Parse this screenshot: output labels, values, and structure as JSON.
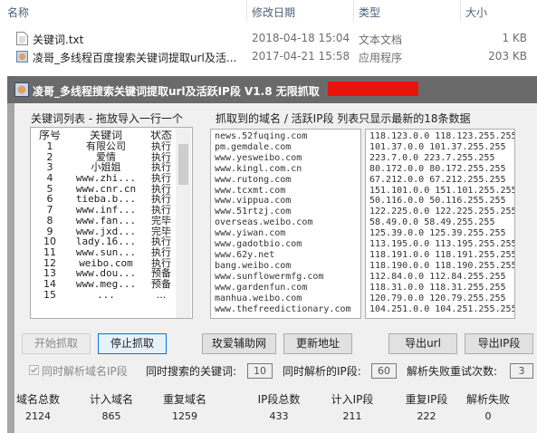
{
  "explorer": {
    "columns": {
      "name": "名称",
      "date": "修改日期",
      "type": "类型",
      "size": "大小"
    },
    "files": [
      {
        "name": "关键词.txt",
        "date": "2018-04-18 15:04",
        "type": "文本文档",
        "size": "1 KB"
      },
      {
        "name": "凌哥_多线程百度搜索关键词提取url及活...",
        "date": "2017-04-21 15:58",
        "type": "应用程序",
        "size": "203 KB"
      }
    ]
  },
  "window": {
    "title": "凌哥_多线程搜索关键词提取url及活跃IP段 V1.8 无限抓取"
  },
  "keyword_panel": {
    "label": "关键词列表 - 拖放导入一行一个",
    "headers": [
      "序号",
      "关键词",
      "状态"
    ],
    "rows": [
      [
        "1",
        "有限公司",
        "执行"
      ],
      [
        "2",
        "爱情",
        "执行"
      ],
      [
        "3",
        "小姐姐",
        "执行"
      ],
      [
        "4",
        "www.zhi...",
        "执行"
      ],
      [
        "5",
        "www.cnr.cn",
        "执行"
      ],
      [
        "6",
        "tieba.b...",
        "执行"
      ],
      [
        "7",
        "www.inf...",
        "执行"
      ],
      [
        "8",
        "www.fan...",
        "完毕"
      ],
      [
        "9",
        "www.jxd...",
        "完毕"
      ],
      [
        "10",
        "lady.16...",
        "执行"
      ],
      [
        "11",
        "www.sun...",
        "执行"
      ],
      [
        "12",
        "weibo.com",
        "执行"
      ],
      [
        "13",
        "www.dou...",
        "预备"
      ],
      [
        "14",
        "www.meg...",
        "预备"
      ],
      [
        "15",
        "...",
        "..."
      ]
    ]
  },
  "domain_panel": {
    "label": "抓取到的域名 / 活跃IP段   列表只显示最新的18条数据",
    "domains": [
      "news.52fuqing.com",
      "pm.gemdale.com",
      "www.yesweibo.com",
      "www.kingl.com.cn",
      "www.rutong.com",
      "www.tcxmt.com",
      "www.vippua.com",
      "www.51rtzj.com",
      "overseas.weibo.com",
      "www.yiwan.com",
      "www.gadotbio.com",
      "www.62y.net",
      "bang.weibo.com",
      "www.sunflowermfg.com",
      "www.gardenfun.com",
      "manhua.weibo.com",
      "www.thefreedictionary.com"
    ],
    "ip_ranges": [
      "118.123.0.0 118.123.255.255",
      "101.37.0.0 101.37.255.255",
      "223.7.0.0 223.7.255.255",
      "80.172.0.0 80.172.255.255",
      "67.212.0.0 67.212.255.255",
      "151.101.0.0 151.101.255.255",
      "50.116.0.0 50.116.255.255",
      "122.225.0.0 122.225.255.255",
      "58.49.0.0 58.49.255.255",
      "125.39.0.0 125.39.255.255",
      "113.195.0.0 113.195.255.255",
      "118.191.0.0 118.191.255.255",
      "118.190.0.0 118.190.255.255",
      "112.84.0.0 112.84.255.255",
      "118.31.0.0 118.31.255.255",
      "120.79.0.0 120.79.255.255",
      "104.251.0.0 104.251.255.255"
    ]
  },
  "buttons": {
    "start": "开始抓取",
    "stop": "停止抓取",
    "help": "玫爱辅助网",
    "update": "更新地址",
    "export_url": "导出url",
    "export_ip": "导出IP段"
  },
  "options": {
    "parse_checkbox": "同时解析域名IP段",
    "concurrent_keywords_label": "同时搜索的关键词:",
    "concurrent_keywords": "10",
    "concurrent_ip_label": "同时解析的IP段:",
    "concurrent_ip": "60",
    "retry_label": "解析失败重试次数:",
    "retry": "3"
  },
  "stats": {
    "labels": [
      "域名总数",
      "计入域名",
      "重复域名",
      "IP段总数",
      "计入IP段",
      "重复IP段",
      "解析失败"
    ],
    "values": [
      "2124",
      "865",
      "1259",
      "433",
      "211",
      "222",
      "0"
    ]
  }
}
